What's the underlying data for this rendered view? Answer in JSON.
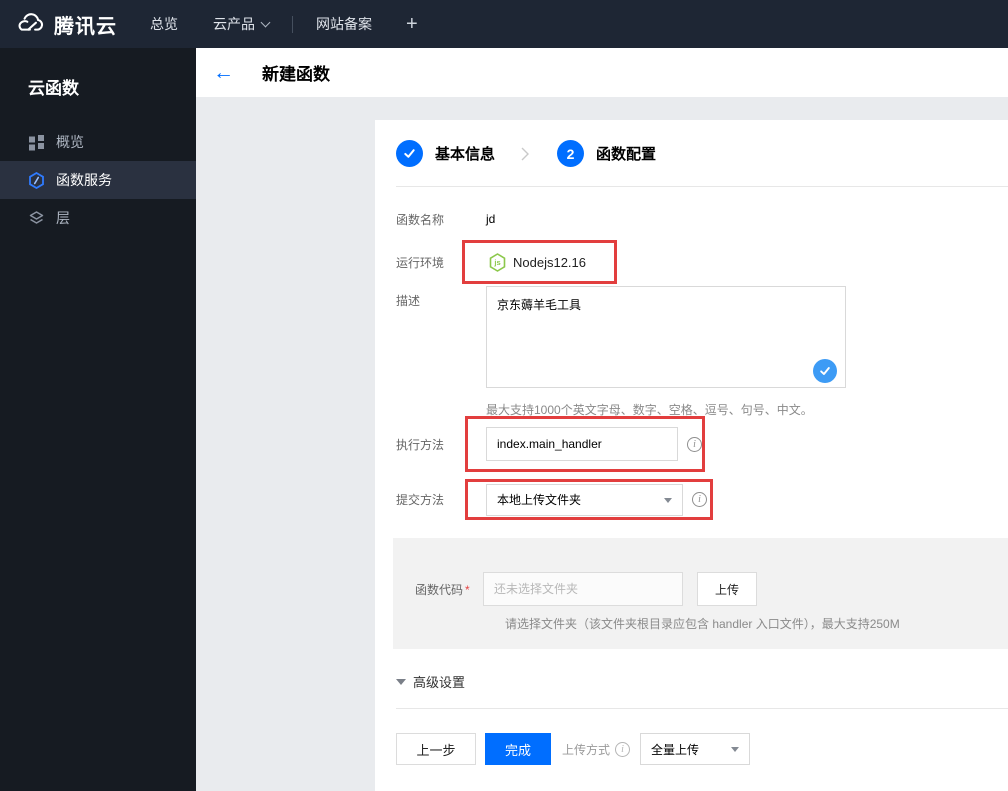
{
  "topbar": {
    "brand": "腾讯云",
    "nav_overview": "总览",
    "nav_products": "云产品",
    "nav_beian": "网站备案",
    "plus": "+"
  },
  "sidebar": {
    "title": "云函数",
    "items": [
      {
        "label": "概览",
        "icon": "grid-icon",
        "active": false
      },
      {
        "label": "函数服务",
        "icon": "hexagon-function-icon",
        "active": true
      },
      {
        "label": "层",
        "icon": "layers-icon",
        "active": false
      }
    ]
  },
  "header": {
    "back": "←",
    "title": "新建函数"
  },
  "steps": {
    "step1_label": "基本信息",
    "step2_number": "2",
    "step2_label": "函数配置"
  },
  "form": {
    "name_label": "函数名称",
    "name_value": "jd",
    "runtime_label": "运行环境",
    "runtime_value": "Nodejs12.16",
    "desc_label": "描述",
    "desc_value": "京东薅羊毛工具",
    "desc_hint": "最大支持1000个英文字母、数字、空格、逗号、句号、中文。",
    "handler_label": "执行方法",
    "handler_value": "index.main_handler",
    "submit_label": "提交方法",
    "submit_value": "本地上传文件夹",
    "code_label": "函数代码",
    "code_required_mark": "*",
    "code_placeholder": "还未选择文件夹",
    "upload_button": "上传",
    "code_hint": "请选择文件夹（该文件夹根目录应包含 handler 入口文件），最大支持250M",
    "advanced_label": "高级设置",
    "info_icon_glyph": "i"
  },
  "footer": {
    "prev_button": "上一步",
    "finish_button": "完成",
    "upload_mode_label": "上传方式",
    "upload_mode_value": "全量上传"
  },
  "colors": {
    "accent_blue": "#006eff",
    "check_blue": "#3d9bf5",
    "highlight_red": "#e23e3e",
    "node_green": "#8cc84b",
    "topbar_bg": "#1e2634",
    "sidebar_bg": "#161b22",
    "sidebar_active_bg": "#2a3140",
    "page_bg": "#e9ebee",
    "section_bg": "#f2f2f2"
  }
}
